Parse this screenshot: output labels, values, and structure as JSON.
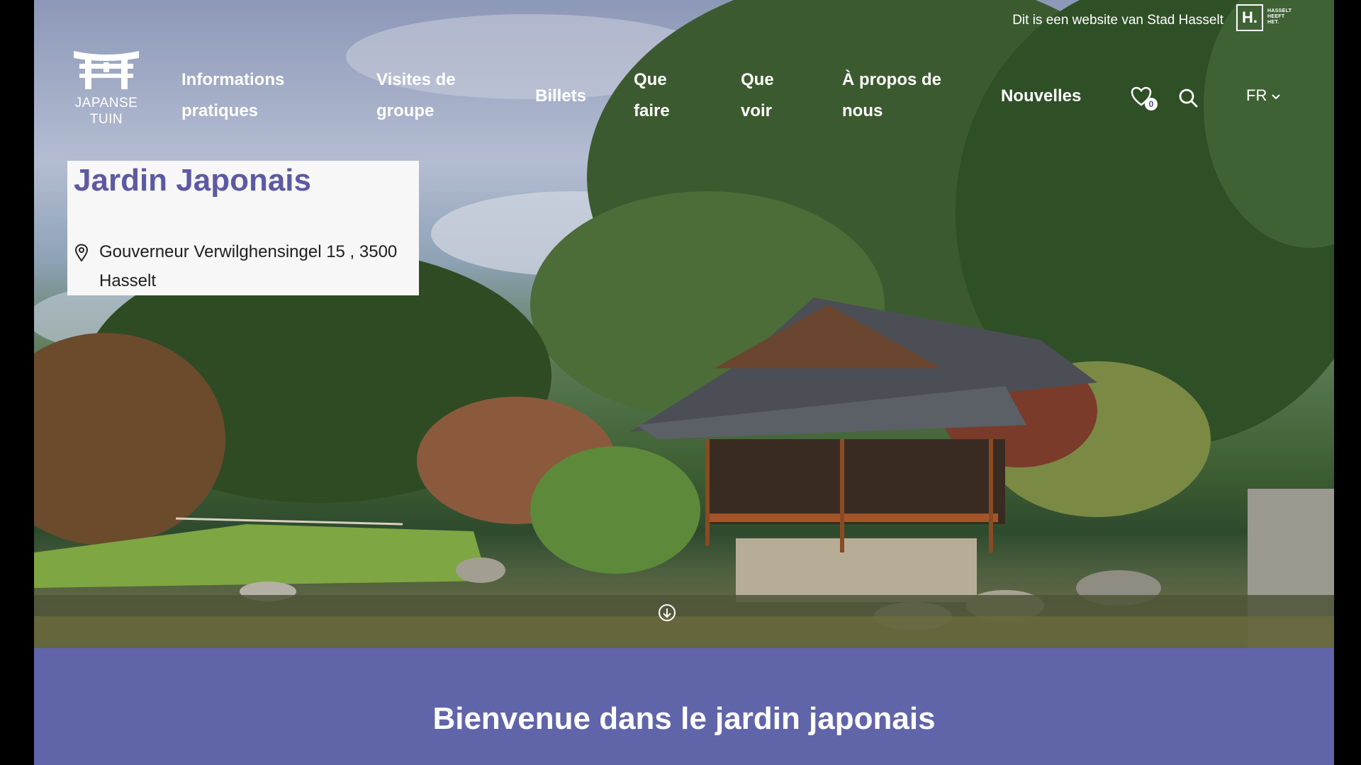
{
  "topbar": {
    "city_text": "Dit is een website van Stad Hasselt",
    "city_logo_letter": "H.",
    "city_logo_tagline": "HASSELT HEEFT HET."
  },
  "logo": {
    "line1": "JAPANSE",
    "line2": "TUIN"
  },
  "nav": {
    "items": [
      {
        "line1": "Informations",
        "line2": "pratiques"
      },
      {
        "line1": "Visites de",
        "line2": "groupe"
      },
      {
        "line1": "Billets",
        "line2": ""
      },
      {
        "line1": "Que",
        "line2": "faire"
      },
      {
        "line1": "Que",
        "line2": "voir"
      },
      {
        "line1": "À propos de",
        "line2": "nous"
      },
      {
        "line1": "Nouvelles",
        "line2": ""
      }
    ],
    "favorites_count": "0",
    "language": "FR"
  },
  "hero": {
    "title": "Jardin Japonais",
    "address": "Gouverneur Verwilghensingel 15 , 3500 Hasselt"
  },
  "welcome": {
    "heading": "Bienvenue dans le jardin japonais"
  },
  "icons": {
    "logo": "torii-gate-icon",
    "favorites": "heart-icon",
    "search": "search-icon",
    "language_toggle": "chevron-down-icon",
    "address": "map-pin-icon",
    "scroll": "arrow-down-circle-icon"
  },
  "colors": {
    "accent": "#6064a9",
    "title": "#5d5aa3",
    "card_bg": "#f7f7f8"
  }
}
